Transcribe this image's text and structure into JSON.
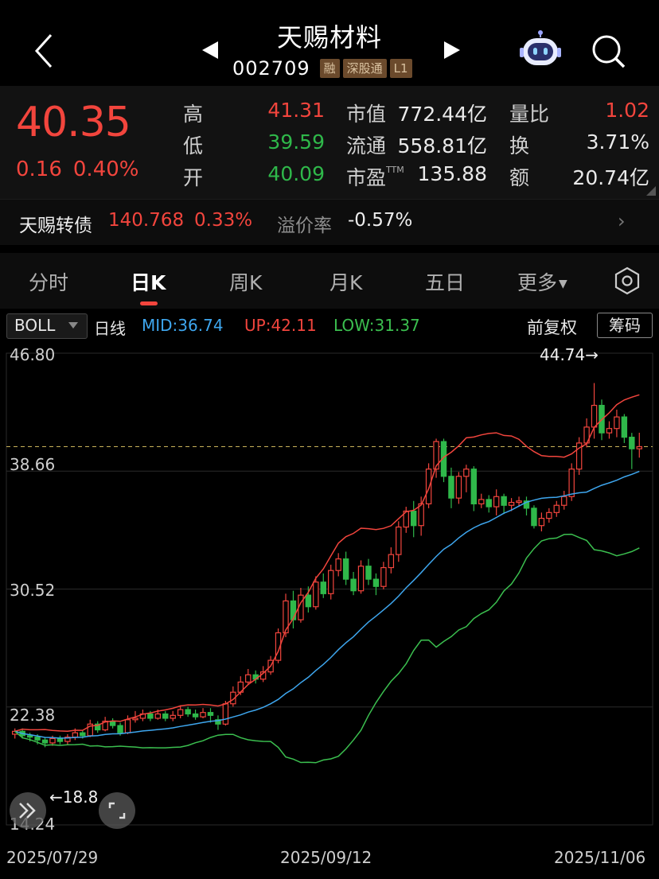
{
  "header": {
    "title": "天赐材料",
    "code": "002709",
    "tags": [
      "融",
      "深股通",
      "L1"
    ],
    "icons": [
      "back-icon",
      "prev-stock-icon",
      "next-stock-icon",
      "robot-assistant-icon",
      "search-icon"
    ]
  },
  "quote": {
    "price": "40.35",
    "change": "0.16",
    "change_pct": "0.40%",
    "stats": [
      {
        "label": "高",
        "value": "41.31",
        "color": "#f2453d"
      },
      {
        "label": "低",
        "value": "39.59",
        "color": "#2fb84a"
      },
      {
        "label": "开",
        "value": "40.09",
        "color": "#2fb84a"
      },
      {
        "label": "市值",
        "value": "772.44亿"
      },
      {
        "label": "流通",
        "value": "558.81亿"
      },
      {
        "label": "市盈",
        "sup": "TTM",
        "value": "135.88"
      },
      {
        "label": "量比",
        "value": "1.02",
        "color": "#f2453d"
      },
      {
        "label": "换",
        "value": "3.71%"
      },
      {
        "label": "额",
        "value": "20.74亿"
      }
    ]
  },
  "bond": {
    "name": "天赐转债",
    "price": "140.768",
    "pct": "0.33%",
    "premium_label": "溢价率",
    "premium_value": "-0.57%"
  },
  "tabs": [
    {
      "label": "分时",
      "active": false
    },
    {
      "label": "日K",
      "active": true
    },
    {
      "label": "周K",
      "active": false
    },
    {
      "label": "月K",
      "active": false
    },
    {
      "label": "五日",
      "active": false
    },
    {
      "label": "更多",
      "active": false
    }
  ],
  "indicator": {
    "name": "BOLL",
    "period": "日线",
    "mid": "MID:36.74",
    "up": "UP:42.11",
    "low": "LOW:31.37",
    "adjust": "前复权",
    "chip": "筹码"
  },
  "chart_data": {
    "type": "candlestick",
    "y_ticks": [
      "46.80",
      "38.66",
      "30.52",
      "22.38",
      "14.24"
    ],
    "ylim": [
      14.24,
      46.8
    ],
    "x_ticks": [
      "2025/07/29",
      "2025/09/12",
      "2025/11/06"
    ],
    "high_marker": "44.74",
    "low_marker": "18.8",
    "current_price_line": 40.35,
    "colors": {
      "up": "#f2453d",
      "down": "#2fb84a",
      "mid": "#3ea6ee",
      "upper": "#f2453d",
      "lower": "#3bbf4f"
    },
    "candles": [
      [
        20.5,
        20.7,
        20.2,
        20.9
      ],
      [
        20.7,
        20.4,
        20.2,
        20.9
      ],
      [
        20.4,
        20.3,
        20.0,
        20.6
      ],
      [
        20.3,
        20.1,
        19.8,
        20.5
      ],
      [
        20.1,
        19.9,
        19.6,
        20.3
      ],
      [
        19.9,
        20.2,
        19.7,
        20.4
      ],
      [
        20.2,
        20.0,
        19.8,
        20.4
      ],
      [
        20.0,
        20.3,
        19.8,
        20.5
      ],
      [
        20.3,
        20.6,
        20.1,
        20.9
      ],
      [
        20.6,
        20.4,
        20.2,
        20.8
      ],
      [
        20.4,
        21.2,
        20.3,
        21.5
      ],
      [
        21.2,
        20.8,
        20.6,
        21.4
      ],
      [
        20.8,
        21.4,
        20.7,
        21.7
      ],
      [
        21.4,
        21.1,
        20.9,
        21.6
      ],
      [
        21.1,
        20.6,
        20.4,
        21.3
      ],
      [
        20.6,
        21.5,
        20.5,
        21.8
      ],
      [
        21.5,
        21.6,
        21.3,
        22.1
      ],
      [
        21.6,
        21.9,
        21.4,
        22.2
      ],
      [
        21.9,
        21.6,
        21.4,
        22.1
      ],
      [
        21.6,
        21.9,
        21.5,
        22.2
      ],
      [
        21.9,
        21.6,
        21.4,
        22.1
      ],
      [
        21.6,
        21.8,
        21.4,
        22.1
      ],
      [
        21.8,
        22.2,
        21.6,
        22.5
      ],
      [
        22.2,
        21.9,
        21.7,
        22.4
      ],
      [
        21.9,
        21.7,
        21.5,
        22.2
      ],
      [
        21.7,
        22.0,
        21.6,
        22.3
      ],
      [
        22.0,
        21.8,
        21.3,
        22.3
      ],
      [
        21.5,
        21.2,
        20.8,
        21.8
      ],
      [
        21.2,
        22.6,
        21.1,
        22.8
      ],
      [
        22.6,
        23.4,
        22.4,
        23.8
      ],
      [
        23.4,
        24.1,
        23.2,
        24.5
      ],
      [
        24.1,
        24.6,
        23.9,
        25.0
      ],
      [
        24.6,
        24.3,
        24.0,
        24.9
      ],
      [
        24.3,
        24.8,
        24.1,
        25.2
      ],
      [
        24.8,
        25.6,
        24.6,
        25.9
      ],
      [
        25.6,
        27.5,
        25.4,
        27.8
      ],
      [
        27.5,
        29.7,
        27.2,
        30.2
      ],
      [
        29.7,
        28.4,
        27.8,
        30.4
      ],
      [
        28.4,
        30.1,
        28.2,
        30.6
      ],
      [
        30.1,
        29.3,
        28.9,
        30.7
      ],
      [
        29.3,
        31.0,
        29.1,
        31.4
      ],
      [
        31.0,
        30.2,
        29.9,
        31.6
      ],
      [
        30.2,
        31.8,
        29.8,
        32.2
      ],
      [
        31.8,
        32.6,
        31.4,
        33.0
      ],
      [
        32.6,
        31.2,
        30.8,
        33.1
      ],
      [
        31.2,
        30.4,
        30.1,
        31.7
      ],
      [
        30.4,
        32.1,
        30.2,
        32.5
      ],
      [
        32.1,
        31.2,
        30.8,
        32.6
      ],
      [
        31.2,
        30.7,
        30.1,
        31.6
      ],
      [
        30.7,
        32.0,
        30.5,
        32.4
      ],
      [
        32.0,
        32.9,
        31.6,
        33.4
      ],
      [
        32.9,
        34.8,
        32.4,
        35.2
      ],
      [
        34.8,
        35.9,
        34.4,
        36.2
      ],
      [
        35.9,
        34.9,
        34.1,
        36.6
      ],
      [
        34.9,
        36.4,
        34.2,
        36.9
      ],
      [
        36.4,
        38.8,
        36.1,
        39.2
      ],
      [
        38.8,
        40.7,
        38.2,
        40.9
      ],
      [
        40.7,
        38.3,
        37.9,
        40.9
      ],
      [
        38.3,
        36.8,
        36.1,
        38.9
      ],
      [
        36.8,
        38.3,
        36.4,
        38.6
      ],
      [
        38.3,
        38.8,
        37.2,
        39.1
      ],
      [
        38.8,
        36.4,
        35.9,
        39.0
      ],
      [
        36.4,
        36.7,
        36.1,
        37.1
      ],
      [
        36.7,
        36.2,
        35.8,
        37.0
      ],
      [
        36.2,
        36.9,
        35.6,
        37.4
      ],
      [
        36.9,
        36.3,
        35.7,
        37.1
      ],
      [
        36.3,
        36.5,
        35.9,
        36.8
      ],
      [
        36.5,
        36.6,
        36.2,
        36.9
      ],
      [
        36.6,
        36.1,
        35.6,
        36.9
      ],
      [
        36.1,
        34.9,
        34.7,
        36.3
      ],
      [
        34.9,
        35.4,
        34.5,
        35.8
      ],
      [
        35.4,
        35.8,
        35.1,
        36.1
      ],
      [
        35.8,
        36.3,
        35.5,
        36.6
      ],
      [
        36.3,
        36.9,
        36.0,
        37.3
      ],
      [
        36.9,
        38.8,
        36.6,
        39.2
      ],
      [
        38.8,
        40.6,
        38.4,
        41.0
      ],
      [
        40.6,
        41.7,
        40.3,
        42.3
      ],
      [
        41.7,
        43.2,
        40.9,
        44.74
      ],
      [
        43.2,
        41.3,
        40.8,
        43.6
      ],
      [
        41.3,
        41.6,
        40.9,
        42.1
      ],
      [
        41.6,
        42.4,
        41.0,
        42.9
      ],
      [
        42.4,
        41.0,
        40.6,
        42.6
      ],
      [
        41.0,
        40.2,
        38.8,
        41.3
      ],
      [
        40.2,
        40.35,
        39.59,
        41.31
      ]
    ]
  }
}
